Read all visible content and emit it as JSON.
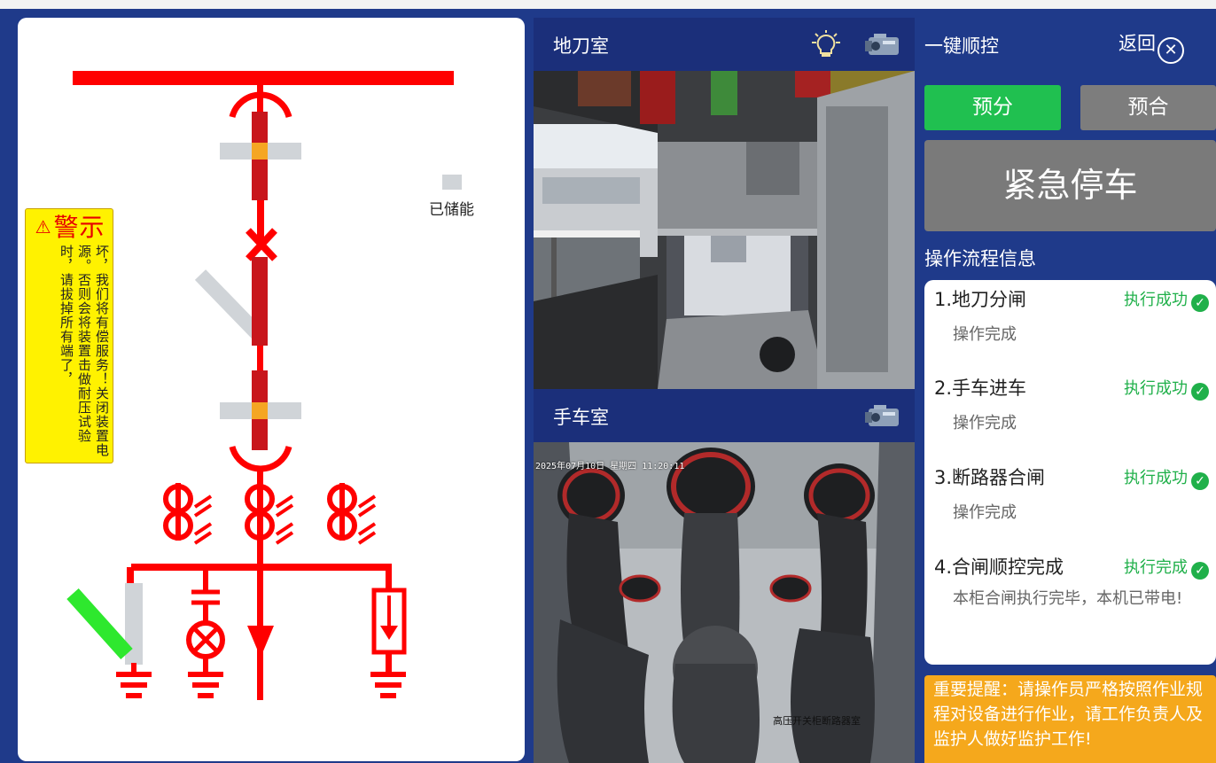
{
  "diagram": {
    "warning_title": "警示",
    "warning_text": "坏，我们将有偿服务！关闭装置电源。否则会将装置击做耐压试验时，请拔掉所有端了，",
    "stored_energy_label": "已储能",
    "colors": {
      "bus": "#ff0000",
      "breaker": "#cc1a1a",
      "earth_switch_closed": "#2ee82e",
      "disconnect_open": "#d0d4d8"
    }
  },
  "cameras": [
    {
      "title": "地刀室",
      "icons": [
        "light-bulb-icon",
        "camera-icon"
      ]
    },
    {
      "title": "手车室",
      "icons": [
        "camera-icon"
      ],
      "osd_datetime": "2025年07月10日 星期四 11:20:11",
      "osd_label": "高压开关柜断路器室"
    }
  ],
  "control": {
    "title": "一键顺控",
    "back_label": "返回",
    "pre_open_label": "预分",
    "pre_close_label": "预合",
    "estop_label": "紧急停车",
    "flow_title": "操作流程信息",
    "steps": [
      {
        "name": "1.地刀分闸",
        "status": "执行成功",
        "detail": "操作完成"
      },
      {
        "name": "2.手车进车",
        "status": "执行成功",
        "detail": "操作完成"
      },
      {
        "name": "3.断路器合闸",
        "status": "执行成功",
        "detail": "操作完成"
      },
      {
        "name": "4.合闸顺控完成",
        "status": "执行完成",
        "detail": "本柜合闸执行完毕，本机已带电!"
      }
    ],
    "reminder": "重要提醒：请操作员严格按照作业规程对设备进行作业，请工作负责人及监护人做好监护工作!",
    "colors": {
      "success": "#20b04a",
      "pre_open_bg": "#20c050",
      "pre_close_bg": "#7d7d7d",
      "estop_bg": "#7a7a7a",
      "reminder_bg": "#f5a81c"
    }
  }
}
